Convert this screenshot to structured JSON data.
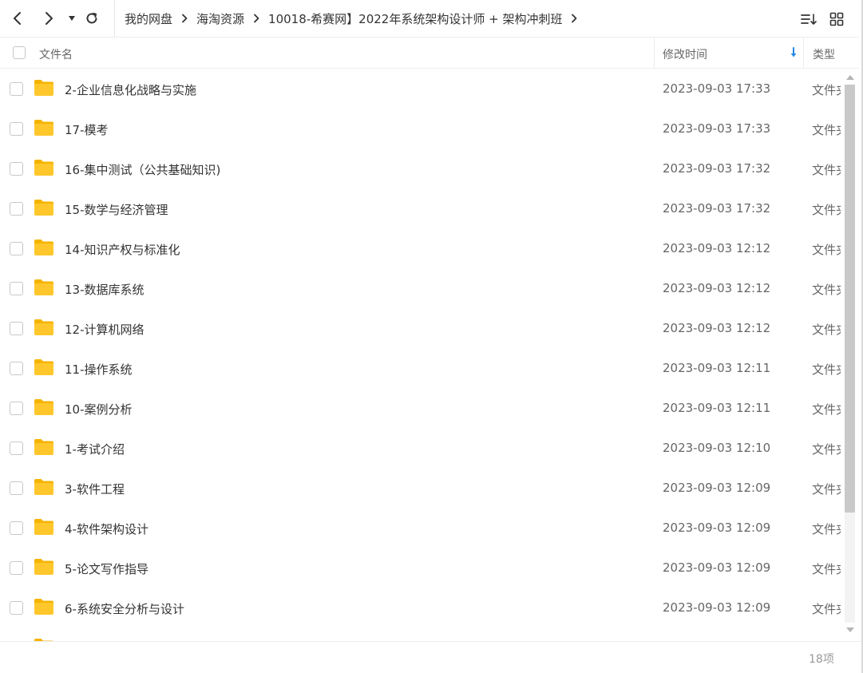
{
  "toolbar": {
    "back_icon": "chevron-left-icon",
    "forward_icon": "chevron-right-icon",
    "history_icon": "caret-down-icon",
    "refresh_icon": "refresh-icon",
    "sort_icon": "sort-list-icon",
    "grid_icon": "grid-view-icon"
  },
  "breadcrumb": [
    "我的网盘",
    "海淘资源",
    "10018-希赛网】2022年系统架构设计师 + 架构冲刺班"
  ],
  "header": {
    "name": "文件名",
    "modified": "修改时间",
    "type": "类型"
  },
  "files": [
    {
      "name": "2-企业信息化战略与实施",
      "modified": "2023-09-03 17:33",
      "type": "文件夹"
    },
    {
      "name": "17-模考",
      "modified": "2023-09-03 17:33",
      "type": "文件夹"
    },
    {
      "name": "16-集中测试（公共基础知识)",
      "modified": "2023-09-03 17:32",
      "type": "文件夹"
    },
    {
      "name": "15-数学与经济管理",
      "modified": "2023-09-03 17:32",
      "type": "文件夹"
    },
    {
      "name": "14-知识产权与标准化",
      "modified": "2023-09-03 12:12",
      "type": "文件夹"
    },
    {
      "name": "13-数据库系统",
      "modified": "2023-09-03 12:12",
      "type": "文件夹"
    },
    {
      "name": "12-计算机网络",
      "modified": "2023-09-03 12:12",
      "type": "文件夹"
    },
    {
      "name": "11-操作系统",
      "modified": "2023-09-03 12:11",
      "type": "文件夹"
    },
    {
      "name": "10-案例分析",
      "modified": "2023-09-03 12:11",
      "type": "文件夹"
    },
    {
      "name": "1-考试介绍",
      "modified": "2023-09-03 12:10",
      "type": "文件夹"
    },
    {
      "name": "3-软件工程",
      "modified": "2023-09-03 12:09",
      "type": "文件夹"
    },
    {
      "name": "4-软件架构设计",
      "modified": "2023-09-03 12:09",
      "type": "文件夹"
    },
    {
      "name": "5-论文写作指导",
      "modified": "2023-09-03 12:09",
      "type": "文件夹"
    },
    {
      "name": "6-系统安全分析与设计",
      "modified": "2023-09-03 12:09",
      "type": "文件夹"
    }
  ],
  "footer": {
    "count": "18项"
  },
  "colors": {
    "folder": "#ffc72c",
    "folder_dark": "#f5b400",
    "sort_accent": "#1e88e5",
    "scroll_thumb": "#c9c9c9"
  }
}
